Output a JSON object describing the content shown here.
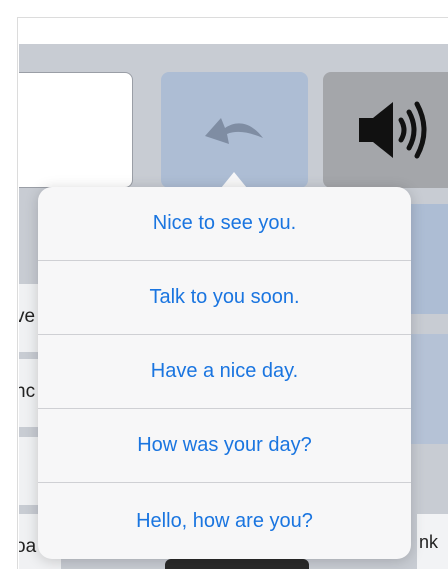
{
  "background": {
    "side_fragments": [
      "ve",
      "nc",
      "",
      "oa"
    ],
    "right_fragment": "nk"
  },
  "toolbar": {
    "undo_icon": "undo-arrow-icon",
    "speak_icon": "speaker-icon"
  },
  "phrase_menu": {
    "items": [
      {
        "label": "Nice to see you."
      },
      {
        "label": "Talk to you soon."
      },
      {
        "label": "Have a nice day."
      },
      {
        "label": "How was your day?"
      },
      {
        "label": "Hello, how are you?"
      }
    ]
  },
  "colors": {
    "accent": "#1a75e0",
    "tile_blue": "#adbdd4",
    "tile_gray": "#a4a6aa",
    "app_bg": "#c8ccd3"
  }
}
